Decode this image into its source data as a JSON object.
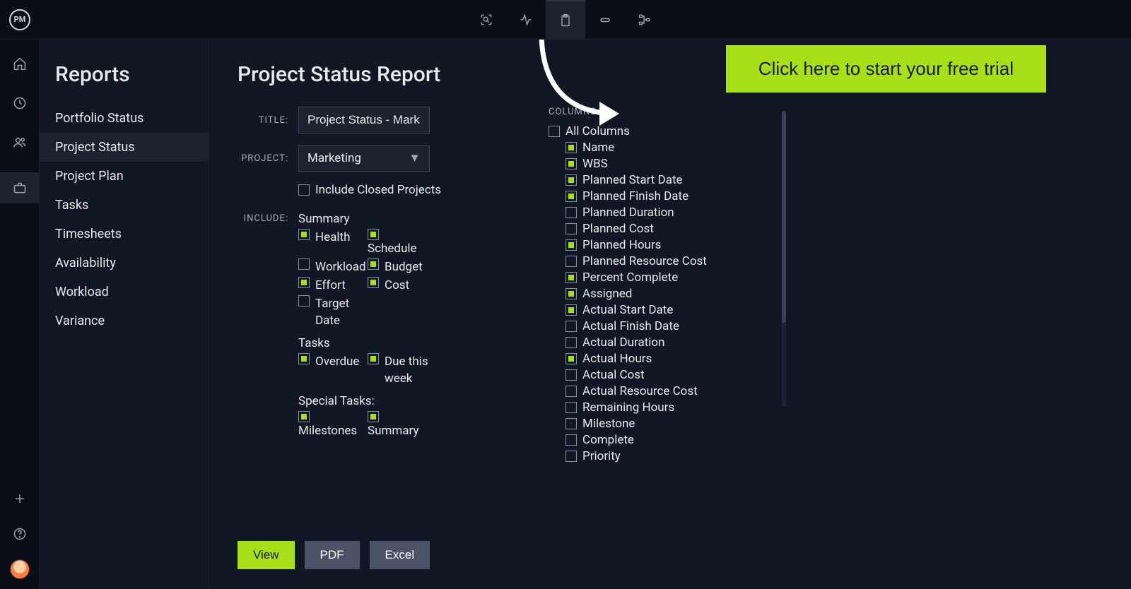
{
  "logo": "PM",
  "sidebar": {
    "title": "Reports",
    "items": [
      "Portfolio Status",
      "Project Status",
      "Project Plan",
      "Tasks",
      "Timesheets",
      "Availability",
      "Workload",
      "Variance"
    ],
    "activeIndex": 1
  },
  "page": {
    "title": "Project Status Report",
    "labels": {
      "title": "TITLE:",
      "project": "PROJECT:",
      "include": "INCLUDE:",
      "columns": "COLUMNS:"
    },
    "titleValue": "Project Status - Mark",
    "projectValue": "Marketing",
    "includeClosed": {
      "label": "Include Closed Projects",
      "checked": false
    },
    "summary": {
      "heading": "Summary",
      "items": [
        {
          "l": "Health",
          "lc": true,
          "r": "Schedule",
          "rc": true,
          "rLabelOffset": true
        },
        {
          "l": "Workload",
          "lc": false,
          "r": "Budget",
          "rc": true
        },
        {
          "l": "Effort",
          "lc": true,
          "r": "Cost",
          "rc": true
        },
        {
          "l": "Target Date",
          "lc": false,
          "r": "",
          "rc": false,
          "noRight": true
        }
      ]
    },
    "tasks": {
      "heading": "Tasks",
      "items": [
        {
          "l": "Overdue",
          "lc": true,
          "r": "Due this week",
          "rc": true
        }
      ]
    },
    "special": {
      "heading": "Special Tasks:",
      "items": [
        {
          "l": "Milestones",
          "lc": true,
          "r": "Summary",
          "rc": true,
          "labelBelow": true
        }
      ]
    }
  },
  "columns": {
    "all": {
      "label": "All Columns",
      "checked": false
    },
    "items": [
      {
        "label": "Name",
        "checked": true
      },
      {
        "label": "WBS",
        "checked": true
      },
      {
        "label": "Planned Start Date",
        "checked": true
      },
      {
        "label": "Planned Finish Date",
        "checked": true
      },
      {
        "label": "Planned Duration",
        "checked": false
      },
      {
        "label": "Planned Cost",
        "checked": false
      },
      {
        "label": "Planned Hours",
        "checked": true
      },
      {
        "label": "Planned Resource Cost",
        "checked": false
      },
      {
        "label": "Percent Complete",
        "checked": true
      },
      {
        "label": "Assigned",
        "checked": true
      },
      {
        "label": "Actual Start Date",
        "checked": true
      },
      {
        "label": "Actual Finish Date",
        "checked": false
      },
      {
        "label": "Actual Duration",
        "checked": false
      },
      {
        "label": "Actual Hours",
        "checked": true
      },
      {
        "label": "Actual Cost",
        "checked": false
      },
      {
        "label": "Actual Resource Cost",
        "checked": false
      },
      {
        "label": "Remaining Hours",
        "checked": false
      },
      {
        "label": "Milestone",
        "checked": false
      },
      {
        "label": "Complete",
        "checked": false
      },
      {
        "label": "Priority",
        "checked": false
      }
    ]
  },
  "buttons": {
    "view": "View",
    "pdf": "PDF",
    "excel": "Excel"
  },
  "cta": "Click here to start your free trial"
}
